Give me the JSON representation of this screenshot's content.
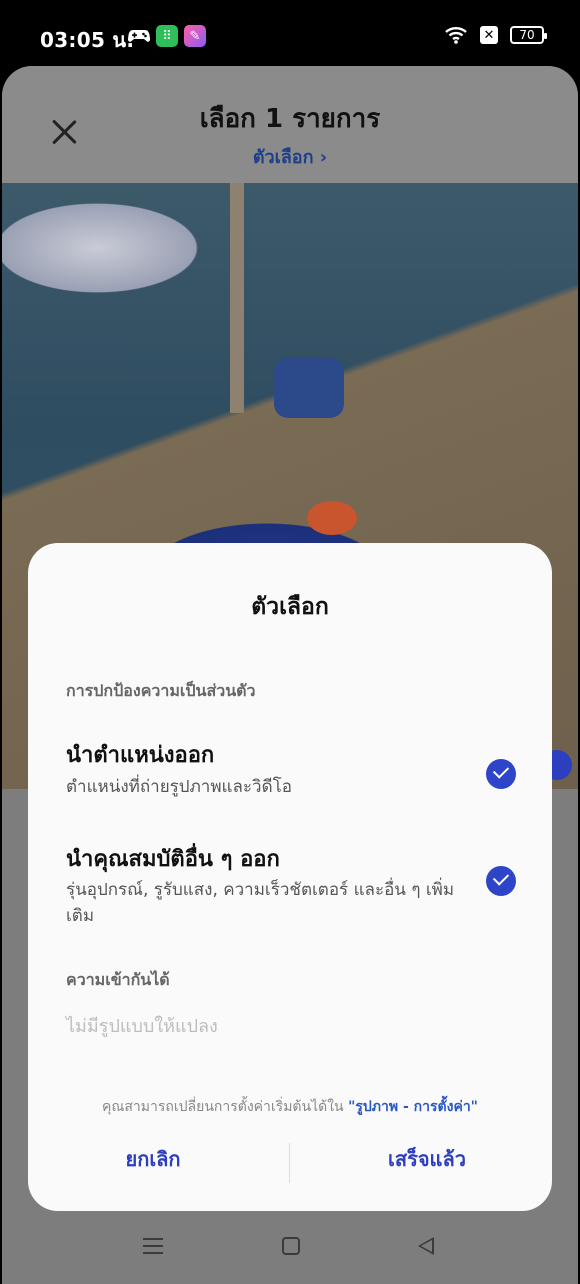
{
  "status_bar": {
    "time": "03:05 น.",
    "battery": "70",
    "app_icons": [
      "game-controller-icon",
      "green-app-icon",
      "pink-app-icon"
    ],
    "system_icons": [
      "wifi-icon",
      "notification-x-icon",
      "battery-icon"
    ]
  },
  "sheet": {
    "title": "เลือก 1 รายการ",
    "options_link": "ตัวเลือก ›"
  },
  "dialog": {
    "title": "ตัวเลือก",
    "privacy_section": "การปกป้องความเป็นส่วนตัว",
    "option_location": {
      "title": "นำตำแหน่งออก",
      "subtitle": "ตำแหน่งที่ถ่ายรูปภาพและวิดีโอ",
      "checked": true
    },
    "option_properties": {
      "title": "นำคุณสมบัติอื่น ๆ ออก",
      "subtitle": "รุ่นอุปกรณ์, รูรับแสง, ความเร็วชัตเตอร์ และอื่น ๆ เพิ่มเติม",
      "checked": true
    },
    "compat_section": "ความเข้ากันได้",
    "compat_value": "ไม่มีรูปแบบให้แปลง",
    "footnote_text": "คุณสามารถเปลี่ยนการตั้งค่าเริ่มต้นได้ใน ",
    "footnote_link": "\"รูปภาพ - การตั้งค่า\"",
    "cancel_label": "ยกเลิก",
    "done_label": "เสร็จแล้ว"
  },
  "colors": {
    "accent": "#2f45c9",
    "link": "#2a59c7",
    "dialog_bg": "#fafafa"
  }
}
